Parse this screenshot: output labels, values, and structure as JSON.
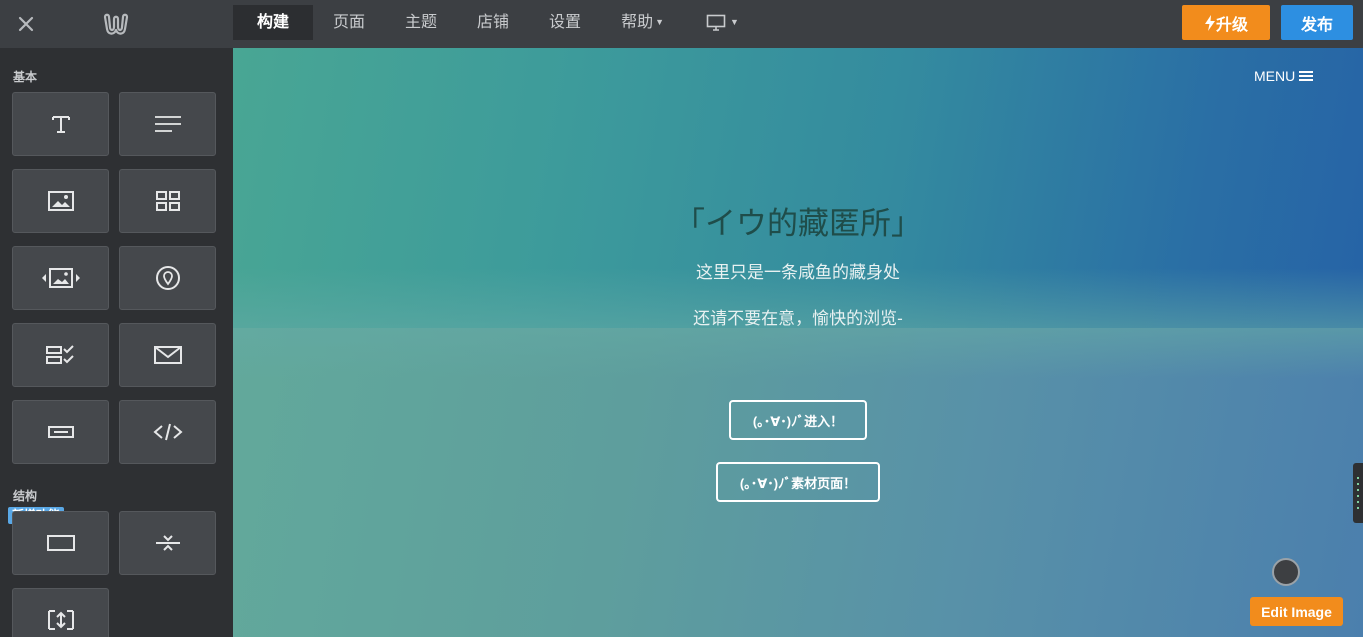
{
  "header": {
    "nav": [
      {
        "label": "构建",
        "active": true
      },
      {
        "label": "页面"
      },
      {
        "label": "主题"
      },
      {
        "label": "店铺"
      },
      {
        "label": "设置"
      },
      {
        "label": "帮助"
      }
    ],
    "upgrade_label": "升级",
    "publish_label": "发布",
    "icons": [
      "close-icon",
      "weebly-logo-icon",
      "monitor-icon",
      "lightning-icon",
      "chevron-down-icon"
    ]
  },
  "sidebar": {
    "basic_title": "基本",
    "structure_title": "结构",
    "new_badge": "新增功能",
    "basic_tiles": [
      "text-icon",
      "paragraph-icon",
      "image-icon",
      "gallery-icon",
      "slideshow-icon",
      "map-icon",
      "form-icon",
      "contact-form-icon",
      "button-icon",
      "embed-code-icon"
    ],
    "structure_tiles": [
      "section-icon",
      "divider-icon",
      "spacer-icon"
    ]
  },
  "canvas": {
    "menu_label": "MENU",
    "title": "「イウ的藏匿所」",
    "subtitle1": "这里只是一条咸鱼的藏身处",
    "subtitle2": "还请不要在意，愉快的浏览-",
    "button1": "(｡･∀･)ﾉﾞ进入！",
    "button2": "(｡･∀･)ﾉﾞ素材页面！",
    "edit_image_label": "Edit Image"
  },
  "colors": {
    "topbar": "#3c3f43",
    "sidebar": "#2e3033",
    "tile": "#45484c",
    "upgrade": "#f28c1c",
    "publish": "#2d8fe1",
    "badge": "#5aa8e6"
  }
}
